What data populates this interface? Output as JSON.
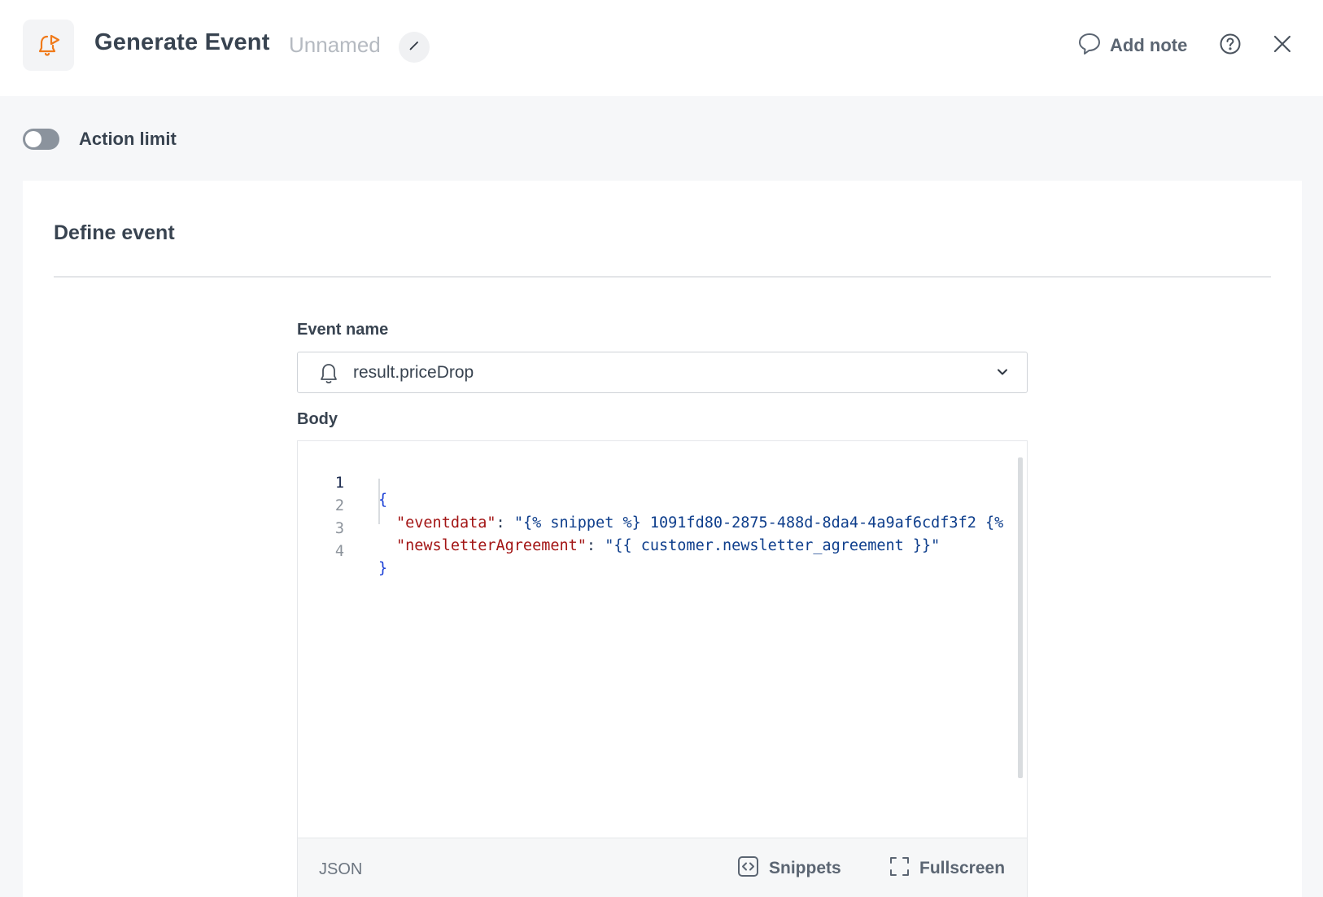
{
  "header": {
    "title": "Generate Event",
    "subtitle": "Unnamed",
    "add_note_label": "Add note",
    "icons": {
      "app": "bell-with-play-icon",
      "edit": "pencil-icon",
      "add_note": "speech-bubble-icon",
      "help": "question-circle-icon",
      "close": "close-icon"
    }
  },
  "action_limit": {
    "label": "Action limit",
    "enabled": false
  },
  "card": {
    "title": "Define event",
    "event_name": {
      "label": "Event name",
      "value": "result.priceDrop",
      "icon": "bell-icon"
    },
    "body": {
      "label": "Body",
      "lines": [
        {
          "num": "1",
          "text": "{"
        },
        {
          "num": "2",
          "key": "\"eventdata\"",
          "value": "\"{% snippet %} 1091fd80-2875-488d-8da4-4a9af6cdf3f2 {%"
        },
        {
          "num": "3",
          "key": "\"newsletterAgreement\"",
          "value": "\"{{ customer.newsletter_agreement }}\""
        },
        {
          "num": "4",
          "text": "}"
        }
      ],
      "footer": {
        "language": "JSON",
        "snippets_label": "Snippets",
        "fullscreen_label": "Fullscreen"
      }
    }
  },
  "colors": {
    "accent_orange": "#f07a1a",
    "toggle_off": "#8b939d",
    "json_key": "#a31515",
    "json_string": "#0e3e8c",
    "json_brace": "#1a3fd6"
  }
}
